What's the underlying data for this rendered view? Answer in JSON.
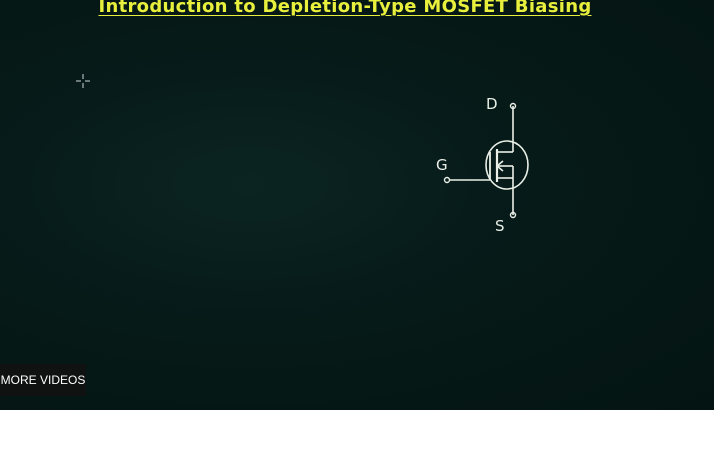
{
  "video": {
    "board_title": "Introduction to Depletion-Type MOSFET Biasing",
    "more_videos_label": "MORE VIDEOS"
  },
  "circuit": {
    "drain_label": "D",
    "gate_label": "G",
    "source_label": "S"
  },
  "colors": {
    "board_background": "#061a18",
    "title_yellow": "#e8ef3c",
    "chalk_white": "#e9efe6"
  },
  "icons": {
    "cursor": "crosshair-cursor-icon"
  }
}
